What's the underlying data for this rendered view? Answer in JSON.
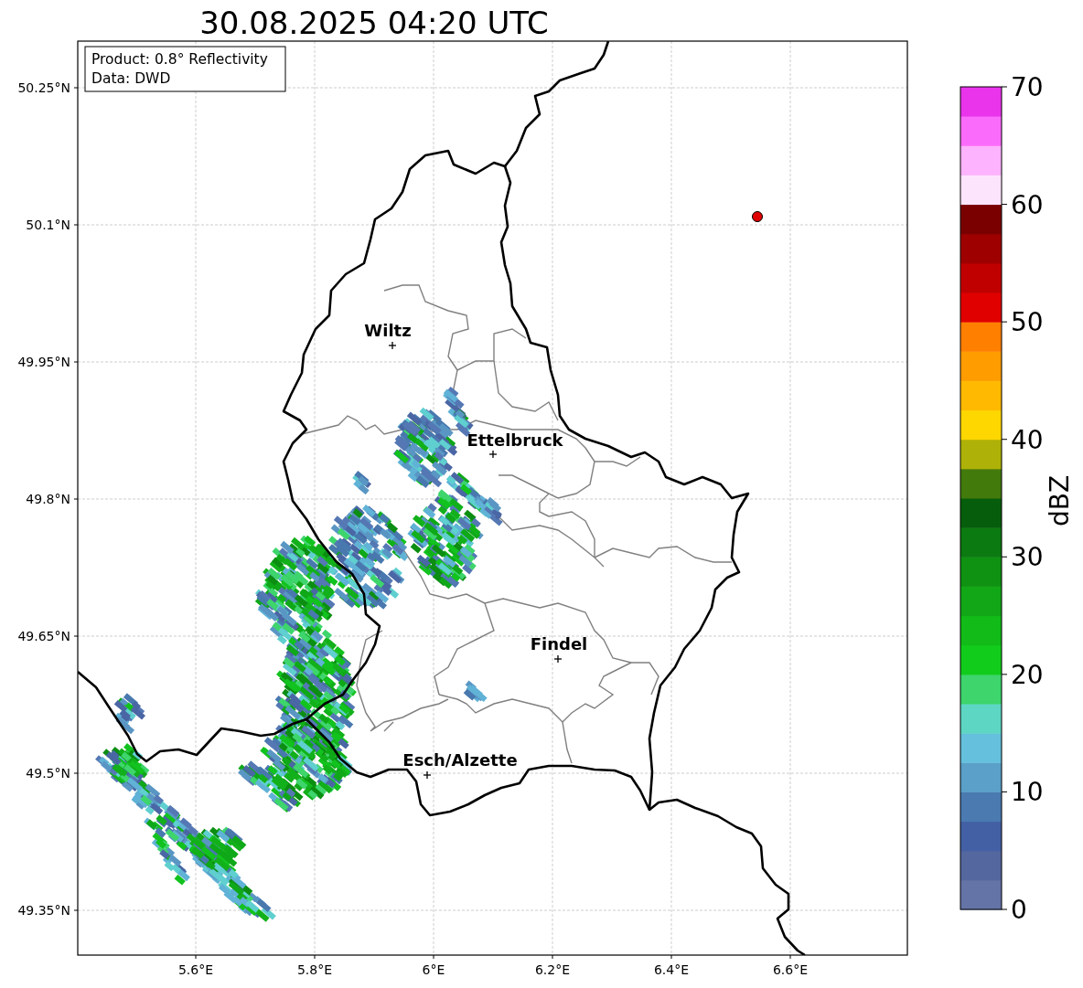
{
  "title": "30.08.2025 04:20 UTC",
  "info_box": {
    "lines": [
      "Product: 0.8° Reflectivity",
      "Data: DWD"
    ]
  },
  "y_ticks": [
    "50.25°N",
    "50.1°N",
    "49.95°N",
    "49.8°N",
    "49.65°N",
    "49.5°N",
    "49.35°N"
  ],
  "x_ticks": [
    "5.6°E",
    "5.8°E",
    "6°E",
    "6.2°E",
    "6.4°E",
    "6.6°E"
  ],
  "cities": [
    "Wiltz",
    "Ettelbruck",
    "Findel",
    "Esch/Alzette"
  ],
  "colorbar": {
    "label": "dBZ",
    "ticks": [
      "70",
      "60",
      "50",
      "40",
      "30",
      "20",
      "10",
      "0"
    ],
    "segments": [
      {
        "color": "#6574a6"
      },
      {
        "color": "#54679e"
      },
      {
        "color": "#4460a4"
      },
      {
        "color": "#4a7ab0"
      },
      {
        "color": "#5aa0c8"
      },
      {
        "color": "#64c0dc"
      },
      {
        "color": "#5ed6c4"
      },
      {
        "color": "#3dd56c"
      },
      {
        "color": "#12cc1c"
      },
      {
        "color": "#12bb18"
      },
      {
        "color": "#12a716"
      },
      {
        "color": "#0f9212"
      },
      {
        "color": "#0b7a10"
      },
      {
        "color": "#065e0c"
      },
      {
        "color": "#437a0c"
      },
      {
        "color": "#aeb208"
      },
      {
        "color": "#ffd700"
      },
      {
        "color": "#ffb900"
      },
      {
        "color": "#ff9c00"
      },
      {
        "color": "#ff7f00"
      },
      {
        "color": "#e00000"
      },
      {
        "color": "#c00000"
      },
      {
        "color": "#9e0000"
      },
      {
        "color": "#7a0000"
      },
      {
        "color": "#fde4fd"
      },
      {
        "color": "#fdb3fd"
      },
      {
        "color": "#fb6bfb"
      },
      {
        "color": "#e934eb"
      }
    ]
  }
}
